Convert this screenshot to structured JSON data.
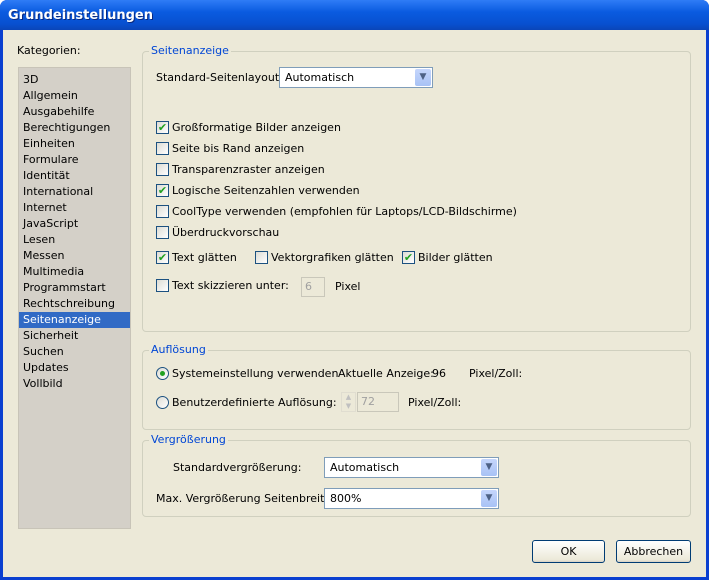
{
  "window": {
    "title": "Grundeinstellungen"
  },
  "categories": {
    "label": "Kategorien:",
    "items": [
      "3D",
      "Allgemein",
      "Ausgabehilfe",
      "Berechtigungen",
      "Einheiten",
      "Formulare",
      "Identität",
      "International",
      "Internet",
      "JavaScript",
      "Lesen",
      "Messen",
      "Multimedia",
      "Programmstart",
      "Rechtschreibung",
      "Seitenanzeige",
      "Sicherheit",
      "Suchen",
      "Updates",
      "Vollbild"
    ],
    "selected": "Seitenanzeige"
  },
  "seitenanzeige": {
    "legend": "Seitenanzeige",
    "layout_label": "Standard-Seitenlayout:",
    "layout_value": "Automatisch",
    "checks": [
      {
        "label": "Großformatige Bilder anzeigen",
        "checked": true
      },
      {
        "label": "Seite bis Rand anzeigen",
        "checked": false
      },
      {
        "label": "Transparenzraster anzeigen",
        "checked": false
      },
      {
        "label": "Logische Seitenzahlen verwenden",
        "checked": true
      },
      {
        "label": "CoolType verwenden (empfohlen für Laptops/LCD-Bildschirme)",
        "checked": false
      },
      {
        "label": "Überdruckvorschau",
        "checked": false
      }
    ],
    "smooth": [
      {
        "label": "Text glätten",
        "checked": true
      },
      {
        "label": "Vektorgrafiken glätten",
        "checked": false
      },
      {
        "label": "Bilder glätten",
        "checked": true
      }
    ],
    "greek": {
      "label": "Text skizzieren unter:",
      "checked": false,
      "value": "6",
      "unit": "Pixel"
    }
  },
  "aufloesung": {
    "legend": "Auflösung",
    "system_label": "Systemeinstellung verwenden",
    "current_label": "Aktuelle Anzeige:",
    "current_value": "96",
    "current_unit": "Pixel/Zoll:",
    "custom_label": "Benutzerdefinierte Auflösung:",
    "custom_value": "72",
    "custom_unit": "Pixel/Zoll:",
    "selected": "system"
  },
  "vergroesserung": {
    "legend": "Vergrößerung",
    "standard_label": "Standardvergrößerung:",
    "standard_value": "Automatisch",
    "max_label": "Max. Vergrößerung Seitenbreite:",
    "max_value": "800%"
  },
  "buttons": {
    "ok": "OK",
    "cancel": "Abbrechen"
  }
}
